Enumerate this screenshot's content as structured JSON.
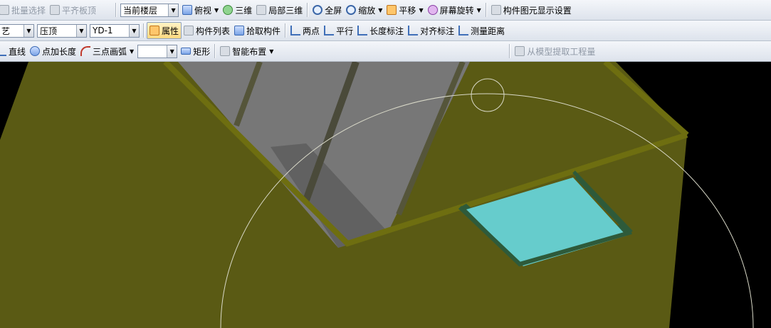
{
  "toolbar1": {
    "batch_select": "批量选择",
    "align_top": "平齐板顶",
    "floor_combo": "当前楼层",
    "top_view": "俯视",
    "view_3d": "三维",
    "local_3d": "局部三维",
    "fullscreen": "全屏",
    "zoom": "缩放",
    "pan": "平移",
    "screen_rotate": "屏幕旋转",
    "element_display": "构件图元显示设置"
  },
  "toolbar2": {
    "combo1": "艺",
    "combo2": "压顶",
    "combo3": "YD-1",
    "properties": "属性",
    "element_list": "构件列表",
    "pick_element": "拾取构件",
    "two_points": "两点",
    "parallel": "平行",
    "length_dim": "长度标注",
    "align_dim": "对齐标注",
    "measure_dist": "测量距离"
  },
  "toolbar3": {
    "line": "直线",
    "point_length": "点加长度",
    "three_point_arc": "三点画弧",
    "combo_blank": "",
    "rectangle": "矩形",
    "smart_layout": "智能布置",
    "extract_qty": "从模型提取工程量"
  },
  "colors": {
    "background": "#000000",
    "wall_olive": "#5a5a14",
    "wall_edge": "#6e6e10",
    "slab_cyan": "#66cccc",
    "slab_edge": "#2e5a3a",
    "pit_grey": "#7a7a7a"
  },
  "icons": [
    "batch-select-icon",
    "align-top-icon",
    "top-view-icon",
    "view-3d-icon",
    "local-3d-icon",
    "fullscreen-icon",
    "zoom-icon",
    "pan-icon",
    "rotate-icon",
    "display-settings-icon",
    "properties-icon",
    "list-icon",
    "pick-icon",
    "two-points-icon",
    "parallel-icon",
    "length-dim-icon",
    "align-dim-icon",
    "measure-icon",
    "line-icon",
    "point-length-icon",
    "arc-icon",
    "rectangle-icon",
    "smart-layout-icon",
    "extract-icon"
  ]
}
